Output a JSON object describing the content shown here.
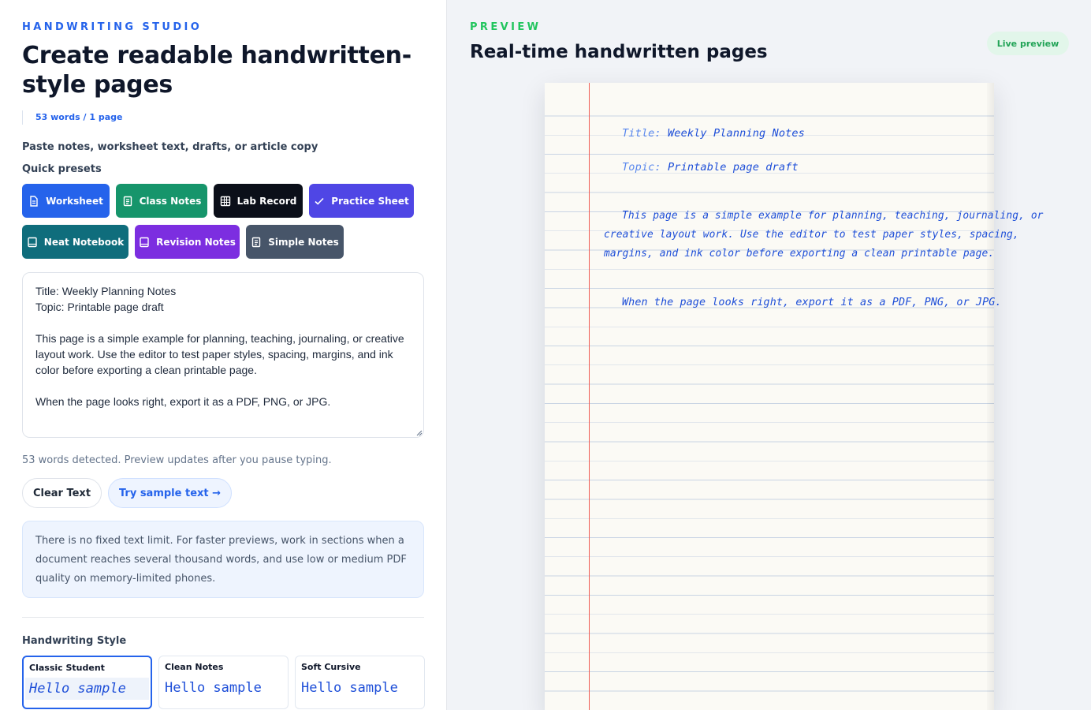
{
  "brand": {
    "eyebrow": "HANDWRITING STUDIO"
  },
  "hero": {
    "title": "Create readable handwritten-style pages",
    "stats": "53 words / 1 page"
  },
  "input": {
    "label": "Paste notes, worksheet text, drafts, or article copy",
    "value": "Title: Weekly Planning Notes\nTopic: Printable page draft\n\nThis page is a simple example for planning, teaching, journaling, or creative layout work. Use the editor to test paper styles, spacing, margins, and ink color before exporting a clean printable page.\n\nWhen the page looks right, export it as a PDF, PNG, or JPG."
  },
  "presets": {
    "label": "Quick presets",
    "items": [
      {
        "label": "Worksheet",
        "color": "#2563eb",
        "icon": "document-icon"
      },
      {
        "label": "Class Notes",
        "color": "#16956b",
        "icon": "notes-icon"
      },
      {
        "label": "Lab Record",
        "color": "#0b0f19",
        "icon": "grid-icon"
      },
      {
        "label": "Practice Sheet",
        "color": "#4f46e5",
        "icon": "check-icon"
      },
      {
        "label": "Neat Notebook",
        "color": "#0f6d7c",
        "icon": "book-icon"
      },
      {
        "label": "Revision Notes",
        "color": "#7c2ee0",
        "icon": "book-icon"
      },
      {
        "label": "Simple Notes",
        "color": "#475569",
        "icon": "notes-icon"
      }
    ]
  },
  "status": {
    "word_hint": "53 words detected. Preview updates after you pause typing."
  },
  "actions": {
    "clear_label": "Clear Text",
    "sample_label": "Try sample text →"
  },
  "info": {
    "text": "There is no fixed text limit. For faster previews, work in sections when a document reaches several thousand words, and use low or medium PDF quality on memory-limited phones."
  },
  "styles": {
    "label": "Handwriting Style",
    "items": [
      {
        "name": "Classic Student",
        "sample": "Hello sample",
        "active": true
      },
      {
        "name": "Clean Notes",
        "sample": "Hello sample",
        "active": false
      },
      {
        "name": "Soft Cursive",
        "sample": "Hello sample",
        "active": false
      }
    ]
  },
  "preview": {
    "eyebrow": "PREVIEW",
    "title": "Real-time handwritten pages",
    "badge": "Live preview",
    "lines": [
      {
        "prefix": "Title: ",
        "text": "Weekly Planning Notes"
      },
      {
        "prefix": "Topic: ",
        "text": "Printable page draft"
      },
      {
        "text": "This page is a simple example for planning, teaching, journaling, or"
      },
      {
        "text": "creative layout work. Use the editor to test paper styles, spacing,"
      },
      {
        "text": "margins, and ink color before exporting a clean printable page."
      },
      {
        "text": "When the page looks right, export it as a PDF, PNG, or JPG."
      }
    ]
  },
  "colors": {
    "accent": "#2563eb",
    "ink": "#1d4ed8",
    "margin_line": "#ef5b52",
    "live": "#22a457"
  }
}
